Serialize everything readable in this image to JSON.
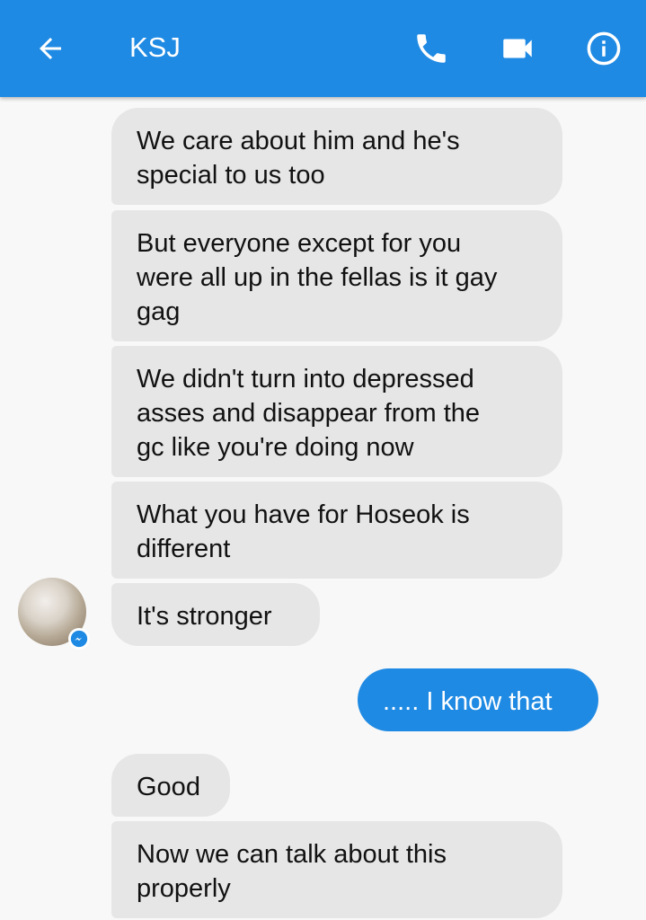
{
  "header": {
    "title": "KSJ",
    "back_icon": "arrow-left-icon",
    "call_icon": "phone-icon",
    "video_icon": "video-camera-icon",
    "info_icon": "info-icon",
    "background_color": "#1f8ae3"
  },
  "messages": [
    {
      "sender": "contact",
      "text": "We care about him and he's\nspecial to us too"
    },
    {
      "sender": "contact",
      "text": "But everyone except for you\nwere all up in the fellas is it gay\ngag"
    },
    {
      "sender": "contact",
      "text": "We didn't turn into depressed\nasses and disappear from the\ngc like you're doing now"
    },
    {
      "sender": "contact",
      "text": "What you have for Hoseok is\ndifferent"
    },
    {
      "sender": "contact",
      "text": "It's stronger"
    },
    {
      "sender": "me",
      "text": "..... I know that"
    },
    {
      "sender": "contact",
      "text": "Good"
    },
    {
      "sender": "contact",
      "text": "Now we can talk about this\nproperly"
    }
  ],
  "contact_avatar": {
    "badge_icon": "messenger-icon"
  },
  "colors": {
    "incoming_bubble": "#e6e6e6",
    "outgoing_bubble": "#1f8ae3",
    "background": "#f8f8f8"
  }
}
